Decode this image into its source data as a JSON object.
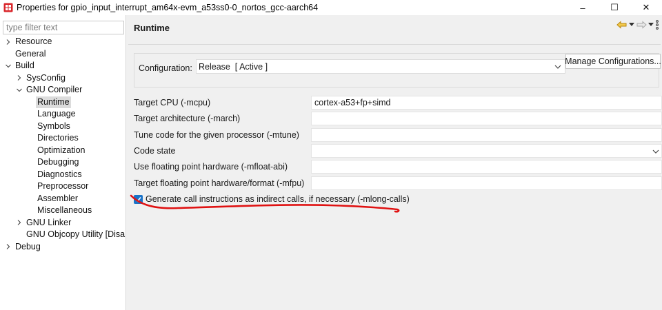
{
  "window": {
    "title": "Properties for gpio_input_interrupt_am64x-evm_a53ss0-0_nortos_gcc-aarch64",
    "controls": {
      "minimize": "–",
      "maximize": "☐",
      "close": "✕"
    }
  },
  "filter": {
    "placeholder": "type filter text",
    "value": ""
  },
  "tree": {
    "items": [
      {
        "label": "Resource",
        "level": 0,
        "expander": "collapsed"
      },
      {
        "label": "General",
        "level": 0,
        "expander": "none"
      },
      {
        "label": "Build",
        "level": 0,
        "expander": "expanded"
      },
      {
        "label": "SysConfig",
        "level": 1,
        "expander": "collapsed"
      },
      {
        "label": "GNU Compiler",
        "level": 1,
        "expander": "expanded"
      },
      {
        "label": "Runtime",
        "level": 2,
        "expander": "none",
        "selected": true
      },
      {
        "label": "Language",
        "level": 2,
        "expander": "none"
      },
      {
        "label": "Symbols",
        "level": 2,
        "expander": "none"
      },
      {
        "label": "Directories",
        "level": 2,
        "expander": "none"
      },
      {
        "label": "Optimization",
        "level": 2,
        "expander": "none"
      },
      {
        "label": "Debugging",
        "level": 2,
        "expander": "none"
      },
      {
        "label": "Diagnostics",
        "level": 2,
        "expander": "none"
      },
      {
        "label": "Preprocessor",
        "level": 2,
        "expander": "none"
      },
      {
        "label": "Assembler",
        "level": 2,
        "expander": "none"
      },
      {
        "label": "Miscellaneous",
        "level": 2,
        "expander": "none"
      },
      {
        "label": "GNU Linker",
        "level": 1,
        "expander": "collapsed"
      },
      {
        "label": "GNU Objcopy Utility  [Disa",
        "level": 1,
        "expander": "none"
      },
      {
        "label": "Debug",
        "level": 0,
        "expander": "collapsed"
      }
    ]
  },
  "page": {
    "title": "Runtime",
    "configuration": {
      "label": "Configuration:",
      "value": "Release  [ Active ]",
      "manage_label": "Manage Configurations..."
    },
    "options": [
      {
        "label": "Target CPU (-mcpu)",
        "value": "cortex-a53+fp+simd",
        "kind": "text"
      },
      {
        "label": "Target architecture (-march)",
        "value": "",
        "kind": "text"
      },
      {
        "label": "Tune code for the given processor (-mtune)",
        "value": "",
        "kind": "text"
      },
      {
        "label": "Code state",
        "value": "",
        "kind": "combo"
      },
      {
        "label": "Use floating point hardware (-mfloat-abi)",
        "value": "",
        "kind": "text"
      },
      {
        "label": "Target floating point hardware/format (-mfpu)",
        "value": "",
        "kind": "text"
      }
    ],
    "long_calls": {
      "label": "Generate call instructions as indirect calls, if necessary (-mlong-calls)",
      "checked": true
    }
  },
  "colors": {
    "accent": "#1a73c8",
    "annotation": "#e01212",
    "nav_arrow": "#d4a21a"
  }
}
